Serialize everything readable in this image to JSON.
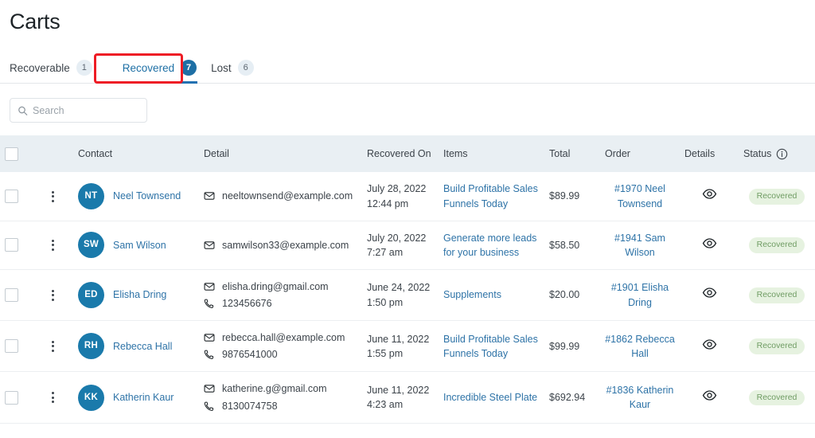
{
  "page": {
    "title": "Carts"
  },
  "tabs": [
    {
      "label": "Recoverable",
      "count": "1",
      "active": false,
      "highlighted": false
    },
    {
      "label": "Recovered",
      "count": "7",
      "active": true,
      "highlighted": true
    },
    {
      "label": "Lost",
      "count": "6",
      "active": false,
      "highlighted": false
    }
  ],
  "search": {
    "placeholder": "Search",
    "value": "",
    "icon": "search-icon"
  },
  "table": {
    "columns": [
      {
        "key": "check",
        "label": ""
      },
      {
        "key": "kebab",
        "label": ""
      },
      {
        "key": "contact",
        "label": "Contact"
      },
      {
        "key": "detail",
        "label": "Detail"
      },
      {
        "key": "date",
        "label": "Recovered On"
      },
      {
        "key": "items",
        "label": "Items"
      },
      {
        "key": "total",
        "label": "Total"
      },
      {
        "key": "order",
        "label": "Order"
      },
      {
        "key": "details",
        "label": "Details"
      },
      {
        "key": "status",
        "label": "Status"
      }
    ],
    "status_info_icon": "info-circle-icon",
    "rows": [
      {
        "initials": "NT",
        "name": "Neel Townsend",
        "email": "neeltownsend@example.com",
        "phone": "",
        "date": "July 28, 2022 12:44 pm",
        "items": "Build Profitable Sales Funnels Today",
        "total": "$89.99",
        "order": "#1970 Neel Townsend",
        "details_icon": "eye-icon",
        "status": "Recovered"
      },
      {
        "initials": "SW",
        "name": "Sam Wilson",
        "email": "samwilson33@example.com",
        "phone": "",
        "date": "July 20, 2022 7:27 am",
        "items": "Generate more leads for your business",
        "total": "$58.50",
        "order": "#1941 Sam Wilson",
        "details_icon": "eye-icon",
        "status": "Recovered"
      },
      {
        "initials": "ED",
        "name": "Elisha Dring",
        "email": "elisha.dring@gmail.com",
        "phone": "123456676",
        "date": "June 24, 2022 1:50 pm",
        "items": "Supplements",
        "total": "$20.00",
        "order": "#1901 Elisha Dring",
        "details_icon": "eye-icon",
        "status": "Recovered"
      },
      {
        "initials": "RH",
        "name": "Rebecca Hall",
        "email": "rebecca.hall@example.com",
        "phone": "9876541000",
        "date": "June 11, 2022 1:55 pm",
        "items": "Build Profitable Sales Funnels Today",
        "total": "$99.99",
        "order": "#1862 Rebecca Hall",
        "details_icon": "eye-icon",
        "status": "Recovered"
      },
      {
        "initials": "KK",
        "name": "Katherin Kaur",
        "email": "katherine.g@gmail.com",
        "phone": "8130074758",
        "date": "June 11, 2022 4:23 am",
        "items": "Incredible Steel Plate",
        "total": "$692.94",
        "order": "#1836 Katherin Kaur",
        "details_icon": "eye-icon",
        "status": "Recovered"
      }
    ]
  },
  "colors": {
    "accent_blue": "#2271b1",
    "link_blue": "#2e73a7",
    "avatar_blue": "#1a7aab",
    "badge_active_bg": "#1d6fa5",
    "badge_inactive_bg": "#e6eef4",
    "status_pill_bg": "#e6f2e0",
    "status_pill_text": "#6f9c63",
    "table_header_bg": "#e9eff3",
    "highlight_red": "#ee1c25"
  }
}
